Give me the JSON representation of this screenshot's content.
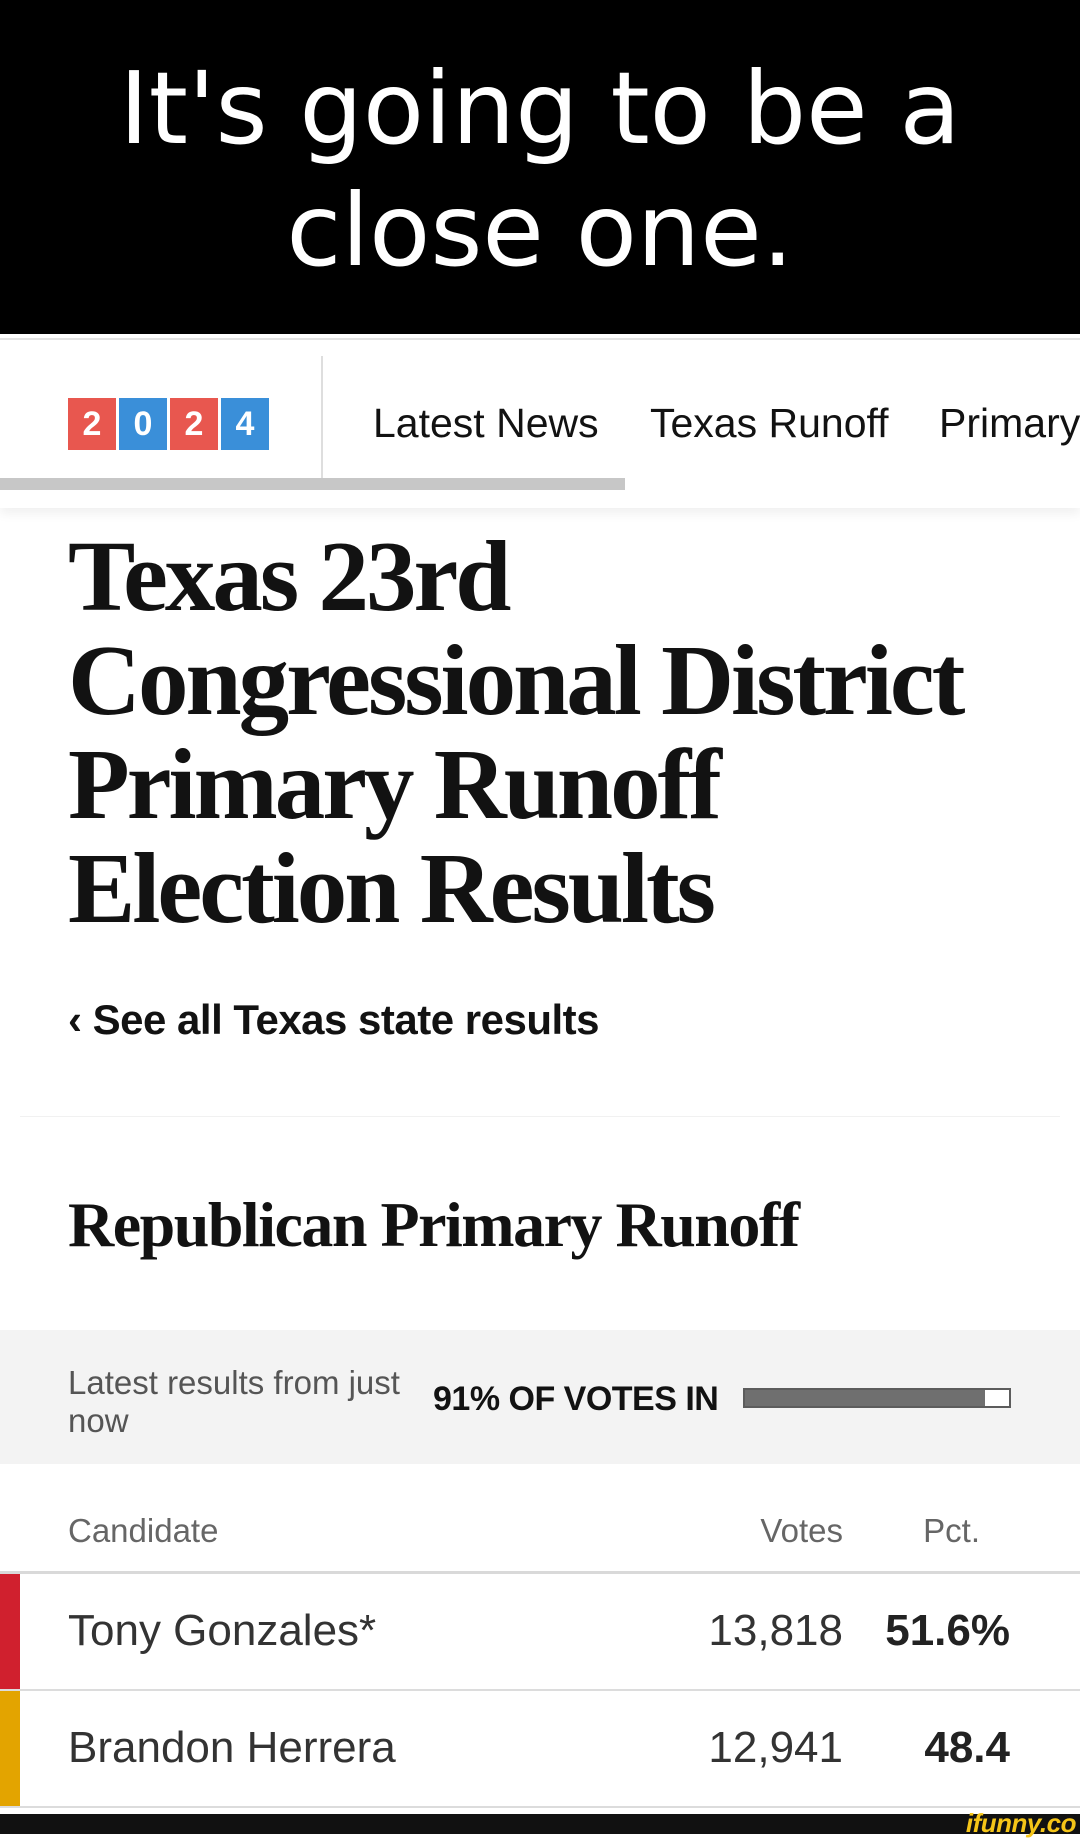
{
  "caption": "It's going to be a\nclose one.",
  "nav": {
    "logo_digits": [
      "2",
      "0",
      "2",
      "4"
    ],
    "logo_colors": [
      "#e8574f",
      "#3a8fd9",
      "#e8574f",
      "#3a8fd9"
    ],
    "items": [
      "Latest News",
      "Texas Runoff",
      "Primary"
    ]
  },
  "headline": "Texas 23rd Congressional District Primary Runoff Election Results",
  "back_link": "‹ See all Texas state results",
  "race_title": "Republican Primary Runoff",
  "status": {
    "latest": "Latest results from just now",
    "votes_in_label": "91% OF VOTES IN",
    "reporting_fraction": 0.91
  },
  "table": {
    "headers": {
      "candidate": "Candidate",
      "votes": "Votes",
      "pct": "Pct."
    },
    "rows": [
      {
        "name": "Tony Gonzales*",
        "votes": "13,818",
        "pct": "51.6%",
        "color": "#d0202e"
      },
      {
        "name": "Brandon Herrera",
        "votes": "12,941",
        "pct": "48.4",
        "color": "#e3a400"
      }
    ]
  },
  "watermark": "ifunny.co"
}
